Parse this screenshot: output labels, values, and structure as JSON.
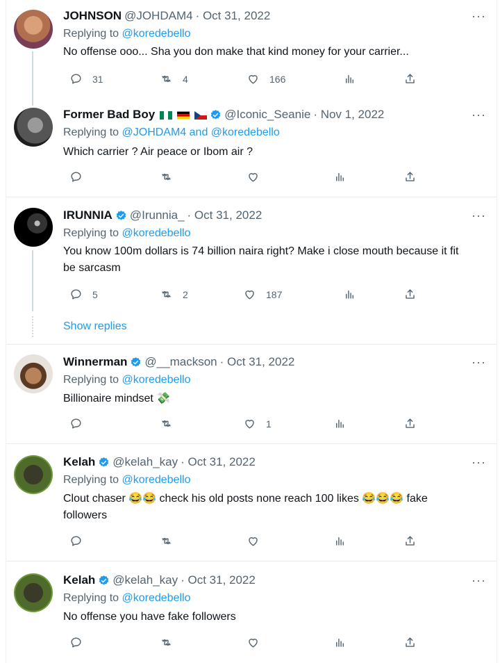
{
  "tweets": [
    {
      "name": "JOHNSON",
      "handle": "@JOHDAM4",
      "date": "· Oct 31, 2022",
      "verified": false,
      "reply_prefix": "Replying to ",
      "reply_to": "@koredebello",
      "text": "No offense ooo... Sha you don make that kind money for your carrier...",
      "replies": "31",
      "retweets": "4",
      "likes": "166",
      "more": "···"
    },
    {
      "name": "Former Bad Boy",
      "handle": "@Iconic_Seanie",
      "date": "· Nov 1, 2022",
      "verified": true,
      "reply_prefix": "Replying to ",
      "reply_to": "@JOHDAM4 and @koredebello",
      "text": "Which carrier ? Air peace or Ibom air  ?",
      "replies": "",
      "retweets": "",
      "likes": "",
      "more": "···"
    },
    {
      "name": "IRUNNIA",
      "handle": "@Irunnia_",
      "date": "· Oct 31, 2022",
      "verified": true,
      "reply_prefix": "Replying to ",
      "reply_to": "@koredebello",
      "text": "You know 100m dollars is 74 billion naira right? Make i close mouth because it fit be sarcasm",
      "replies": "5",
      "retweets": "2",
      "likes": "187",
      "more": "···"
    },
    {
      "name": "Winnerman",
      "handle": "@__mackson",
      "date": "· Oct 31, 2022",
      "verified": true,
      "reply_prefix": "Replying to ",
      "reply_to": "@koredebello",
      "text": "Billionaire mindset 💸",
      "replies": "",
      "retweets": "",
      "likes": "1",
      "more": "···"
    },
    {
      "name": "Kelah",
      "handle": "@kelah_kay",
      "date": "· Oct 31, 2022",
      "verified": true,
      "reply_prefix": "Replying to ",
      "reply_to": "@koredebello",
      "text": "Clout chaser 😂😂 check his old posts none reach 100 likes 😂😂😂 fake followers",
      "replies": "",
      "retweets": "",
      "likes": "",
      "more": "···"
    },
    {
      "name": "Kelah",
      "handle": "@kelah_kay",
      "date": "· Oct 31, 2022",
      "verified": true,
      "reply_prefix": "Replying to ",
      "reply_to": "@koredebello",
      "text": "No offense you have fake followers",
      "replies": "",
      "retweets": "",
      "likes": "",
      "more": "···"
    }
  ],
  "show_replies": "Show replies",
  "colors": {
    "accent": "#1d9bf0",
    "muted": "#536471",
    "text": "#0f1419",
    "divider": "#e6ecf0"
  },
  "icons": [
    "reply-icon",
    "retweet-icon",
    "like-icon",
    "views-icon",
    "share-icon",
    "more-icon",
    "verified-badge-icon"
  ]
}
